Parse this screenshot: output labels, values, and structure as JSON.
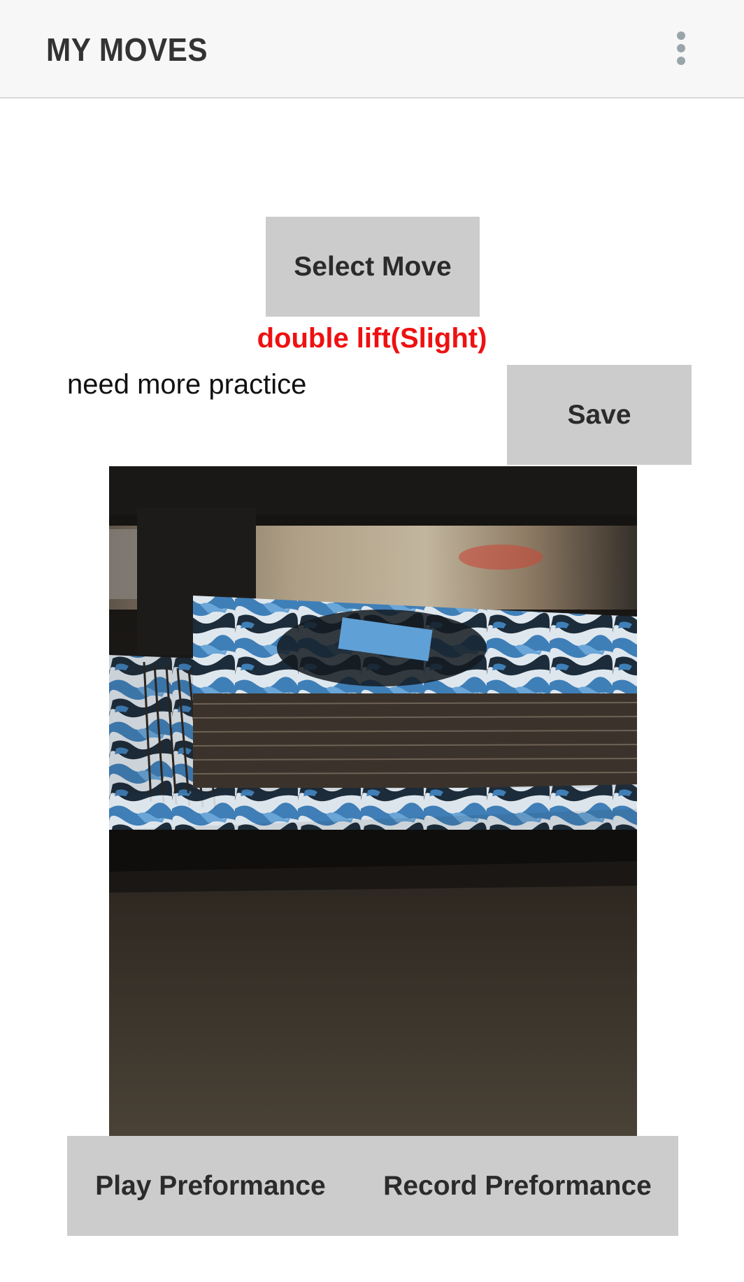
{
  "app_bar": {
    "title": "MY MOVES",
    "menu_icon": "more-vert-icon"
  },
  "controls": {
    "select_move_label": "Select Move",
    "selected_move": "double lift(Slight)",
    "notes_text": "need more practice",
    "save_label": "Save"
  },
  "video": {
    "thumbnail_description_icon": "video-thumbnail"
  },
  "footer": {
    "play_label": "Play Preformance",
    "record_label": "Record Preformance"
  },
  "colors": {
    "app_bar_bg": "#f7f7f7",
    "button_bg": "#cccccc",
    "move_name": "#ee1111",
    "button_text": "#2b2b2b"
  }
}
